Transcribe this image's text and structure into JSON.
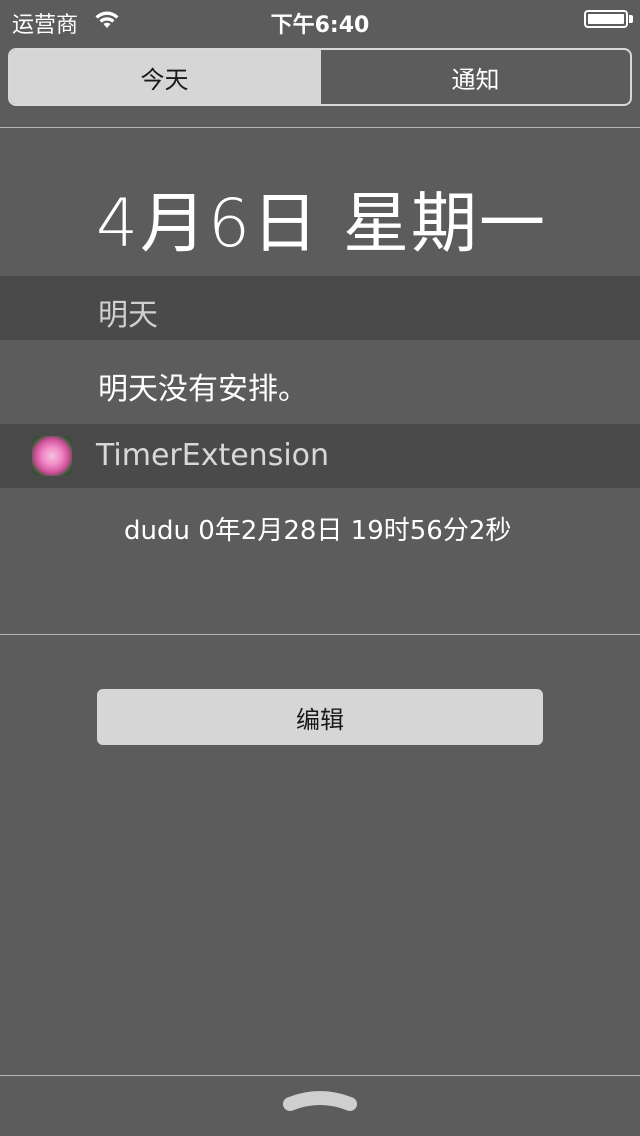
{
  "status_bar": {
    "carrier": "运营商",
    "time": "下午6:40",
    "wifi_icon": "wifi-icon",
    "battery_icon": "battery-icon"
  },
  "tabs": [
    {
      "label": "今天",
      "selected": true
    },
    {
      "label": "通知",
      "selected": false
    }
  ],
  "today": {
    "date_title": "4月6日 星期一"
  },
  "tomorrow_section": {
    "header": "明天",
    "text": "明天没有安排。"
  },
  "extension": {
    "title": "TimerExtension",
    "icon": "rose-app-icon",
    "timer_text": "dudu 0年2月28日 19时56分2秒"
  },
  "edit_button": {
    "label": "编辑"
  },
  "grabber_icon": "chevron-up-handle-icon",
  "colors": {
    "background": "#5c5c5c",
    "section_header": "#4a4a4a",
    "selected_tab": "#d6d6d6"
  }
}
